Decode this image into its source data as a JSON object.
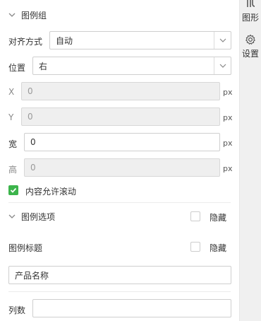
{
  "legend_group": {
    "title": "图例组",
    "align": {
      "label": "对齐方式",
      "value": "自动"
    },
    "position": {
      "label": "位置",
      "value": "右"
    },
    "x": {
      "label": "X",
      "value": "0",
      "unit": "px"
    },
    "y": {
      "label": "Y",
      "value": "0",
      "unit": "px"
    },
    "width": {
      "label": "宽",
      "value": "0",
      "unit": "px"
    },
    "height": {
      "label": "高",
      "value": "0",
      "unit": "px"
    },
    "scroll": {
      "label": "内容允许滚动",
      "checked": true
    }
  },
  "legend_options": {
    "title": "图例选项",
    "hide_label": "隐藏",
    "hide_checked": false
  },
  "legend_title": {
    "label": "图例标题",
    "hide_label": "隐藏",
    "hide_checked": false,
    "value": "产品名称"
  },
  "columns": {
    "label": "列数",
    "value": ""
  },
  "sidebar": {
    "graphics_label": "图形",
    "settings_label": "设置"
  },
  "colors": {
    "accent_green": "#3cb44b",
    "border": "#cfcfcf",
    "disabled_bg": "#efefef"
  }
}
